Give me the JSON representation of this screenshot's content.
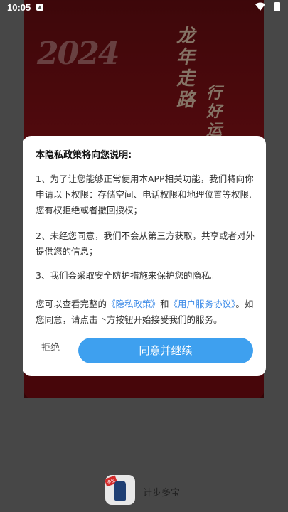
{
  "status_bar": {
    "time": "10:05"
  },
  "poster": {
    "year_text": "2024",
    "slogan_1": "龙年走路",
    "slogan_2": "行好运"
  },
  "dialog": {
    "title": "本隐私政策将向您说明:",
    "para1": "1、为了让您能够正常使用本APP相关功能，我们将向你申请以下权限：存储空间、电话权限和地理位置等权限,您有权拒绝或者撤回授权；",
    "para2": "2、未经您同意，我们不会从第三方获取，共享或者对外提供您的信息；",
    "para3": "3、我们会采取安全防护措施来保护您的隐私。",
    "para4_prefix": "您可以查看完整的",
    "privacy_link": "《隐私政策》",
    "para4_and": "和",
    "agreement_link": "《用户服务协议》",
    "para4_suffix": "。如您同意，请点击下方按钮开始接受我们的服务。",
    "reject_label": "拒绝",
    "agree_label": "同意并继续"
  },
  "footer": {
    "app_name": "计步多宝",
    "logo_badge": "多宝"
  }
}
